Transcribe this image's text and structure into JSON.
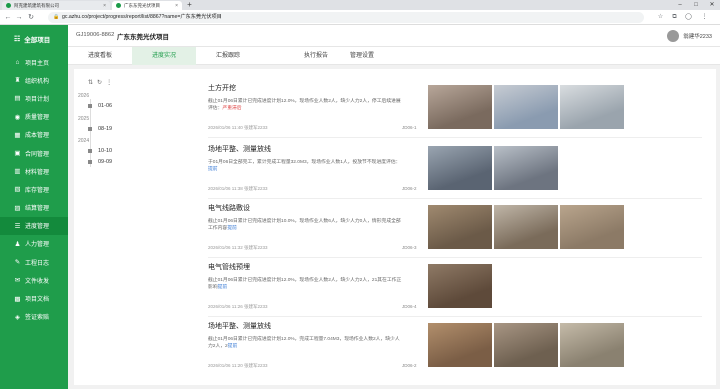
{
  "browser": {
    "tabs": [
      "阿克建筑建筑有限公司",
      "广东东莞光伏项目"
    ],
    "url": "gc.azhu.co/project/progress/report/list/8867?name=广东东莞光伏项目",
    "url_icon": "lock-icon"
  },
  "sidebar": {
    "brand": "全部项目",
    "items": [
      {
        "label": "项目主页",
        "icon": "home-icon"
      },
      {
        "label": "组织机构",
        "icon": "org-icon"
      },
      {
        "label": "项目计划",
        "icon": "plan-icon"
      },
      {
        "label": "质量管理",
        "icon": "quality-icon"
      },
      {
        "label": "成本管理",
        "icon": "cost-icon"
      },
      {
        "label": "合同管理",
        "icon": "contract-icon"
      },
      {
        "label": "材料管理",
        "icon": "material-icon"
      },
      {
        "label": "库存管理",
        "icon": "stock-icon"
      },
      {
        "label": "结算管理",
        "icon": "settle-icon"
      },
      {
        "label": "进度管理",
        "icon": "progress-icon"
      },
      {
        "label": "人力管理",
        "icon": "people-icon"
      },
      {
        "label": "工程日志",
        "icon": "log-icon"
      },
      {
        "label": "文件收发",
        "icon": "file-icon"
      },
      {
        "label": "项目文档",
        "icon": "doc-icon"
      },
      {
        "label": "签证索赔",
        "icon": "claim-icon"
      }
    ],
    "active_index": 9
  },
  "header": {
    "project_code": "GJ19006-8862",
    "project_name": "广东东莞光伏项目",
    "user": "翁建华2233"
  },
  "tabs": [
    "进度看板",
    "进度实况",
    "汇报跟踪",
    "执行报告",
    "管理设置"
  ],
  "active_tab": 1,
  "timeline": {
    "groups": [
      {
        "year": "2026",
        "date": "01-06"
      },
      {
        "year": "2025",
        "date": "08-19"
      },
      {
        "year": "2024",
        "date": "10-10"
      },
      {
        "year": "",
        "date": "09-09"
      }
    ]
  },
  "entries": [
    {
      "title": "土方开挖",
      "desc": "截止01月06日累计已完成进度计划12.0%，现场作业人数2人，缺少人力2人，停工后续进展评估：",
      "status_label": "严重滞后",
      "status_kind": "red",
      "meta": "2026/01/06 11:40   张建军2233",
      "code": "JD06-1",
      "photos": [
        [
          "#7a6a5e",
          "#b8a79a"
        ],
        [
          "#8a9bb0",
          "#c7ccd3"
        ],
        [
          "#9aa4ad",
          "#d9dde0"
        ]
      ]
    },
    {
      "title": "场地平整、测量放线",
      "desc": "于01月06日全部完工，累计完成工程量32.0M3，现场作业人数1人，投放节不现进度评估：",
      "status_label": "提前",
      "status_kind": "blue",
      "meta": "2026/01/06 11:38   张建军2233",
      "code": "JD06-2",
      "photos": [
        [
          "#5a6472",
          "#9aa5b1"
        ],
        [
          "#6d7480",
          "#b9c0c8"
        ]
      ]
    },
    {
      "title": "电气线路敷设",
      "desc": "截止01月06日累计已完成进度计划10.0%，现场作业人数6人，缺少人力0人，情形完成全部工作内容",
      "status_label": "提前",
      "status_kind": "blue",
      "meta": "2026/01/06 11:32   张建军2233",
      "code": "JD06-3",
      "photos": [
        [
          "#6b5a48",
          "#a08a70"
        ],
        [
          "#7a6b5a",
          "#c0b6a8"
        ],
        [
          "#8c7a66",
          "#b9a58d"
        ]
      ]
    },
    {
      "title": "电气管线预埋",
      "desc": "截止01月06日累计已完成进度计划12.0%，现场作业人数2人，缺少人力2人，21其在工作正影响",
      "status_label": "提前",
      "status_kind": "blue",
      "meta": "2026/01/06 11:26   张建军2233",
      "code": "JD06-4",
      "photos": [
        [
          "#5e4a3a",
          "#8f7a66"
        ]
      ]
    },
    {
      "title": "场地平整、测量放线",
      "desc": "截止01月06日累计已完成进度计划12.0%，完成工程量7.04M3，现场作业人数2人，缺少人力2人，2",
      "status_label": "提前",
      "status_kind": "blue",
      "meta": "2026/01/06 11:20   张建军2233",
      "code": "JD06-2",
      "photos": [
        [
          "#7b5e46",
          "#b28f6c"
        ],
        [
          "#6e6050",
          "#a89684"
        ],
        [
          "#8a8170",
          "#c5bba9"
        ]
      ]
    }
  ]
}
